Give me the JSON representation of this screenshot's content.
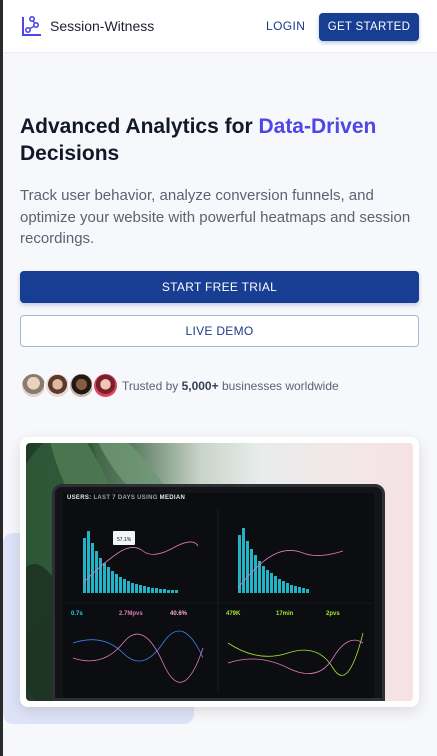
{
  "header": {
    "brand": "Session-Witness",
    "login_label": "LOGIN",
    "cta_label": "GET STARTED"
  },
  "hero": {
    "title_part1": "Advanced Analytics for ",
    "title_accent": "Data-Driven",
    "title_part2": "Decisions",
    "subtitle": "Track user behavior, analyze conversion funnels, and optimize your website with powerful heatmaps and session recordings.",
    "trial_label": "START FREE TRIAL",
    "demo_label": "LIVE DEMO",
    "trusted_prefix": "Trusted by ",
    "trusted_count": "5,000+",
    "trusted_suffix": " businesses worldwide"
  },
  "colors": {
    "primary": "#173e93",
    "accent": "#4f46e5",
    "text_muted": "#5b6272"
  },
  "icons": {
    "logo": "session-witness-logo-icon"
  },
  "showcase": {
    "screen_title_a": "USERS: ",
    "screen_title_b": "LAST 7 DAYS",
    "screen_title_c": " USING ",
    "screen_title_d": "MEDIAN",
    "tooltip_value": "57.1%",
    "metrics": [
      "0.7s",
      "2.7Mpvs",
      "40.6%",
      "479K",
      "17min",
      "2pvs"
    ]
  }
}
